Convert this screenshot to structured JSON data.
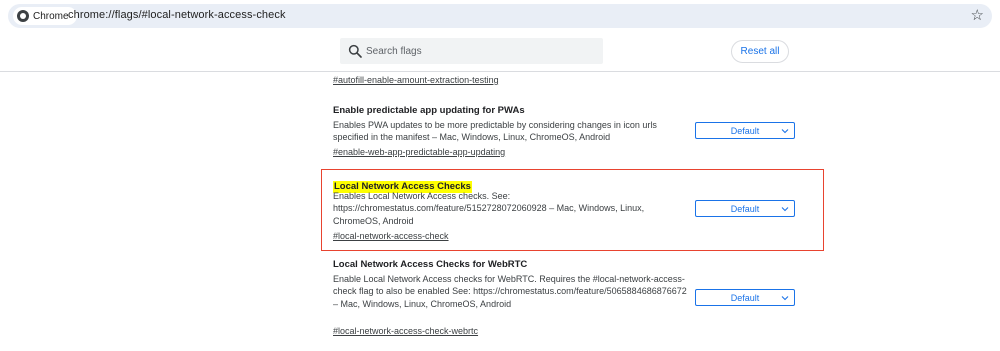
{
  "browser": {
    "chip_label": "Chrome",
    "url": "chrome://flags/#local-network-access-check"
  },
  "header": {
    "search_placeholder": "Search flags",
    "reset_label": "Reset all"
  },
  "flags": [
    {
      "title": "",
      "description": "",
      "link": "#autofill-enable-amount-extraction-testing",
      "select": ""
    },
    {
      "title": "Enable predictable app updating for PWAs",
      "description": "Enables PWA updates to be more predictable by considering changes in icon urls specified in the manifest – Mac, Windows, Linux, ChromeOS, Android",
      "link": "#enable-web-app-predictable-app-updating",
      "select": "Default"
    },
    {
      "title": "Local Network Access Checks",
      "description": "Enables Local Network Access checks. See: https://chromestatus.com/feature/5152728072060928 – Mac, Windows, Linux, ChromeOS, Android",
      "link": "#local-network-access-check",
      "select": "Default"
    },
    {
      "title": "Local Network Access Checks for WebRTC",
      "description": "Enable Local Network Access checks for WebRTC. Requires the #local-network-access-check flag to also be enabled See: https://chromestatus.com/feature/5065884686876672 – Mac, Windows, Linux, ChromeOS, Android",
      "link": "#local-network-access-check-webrtc",
      "select": "Default"
    }
  ],
  "colors": {
    "accent": "#1a73e8",
    "highlight": "#ffff00",
    "outline": "#e8432f"
  }
}
